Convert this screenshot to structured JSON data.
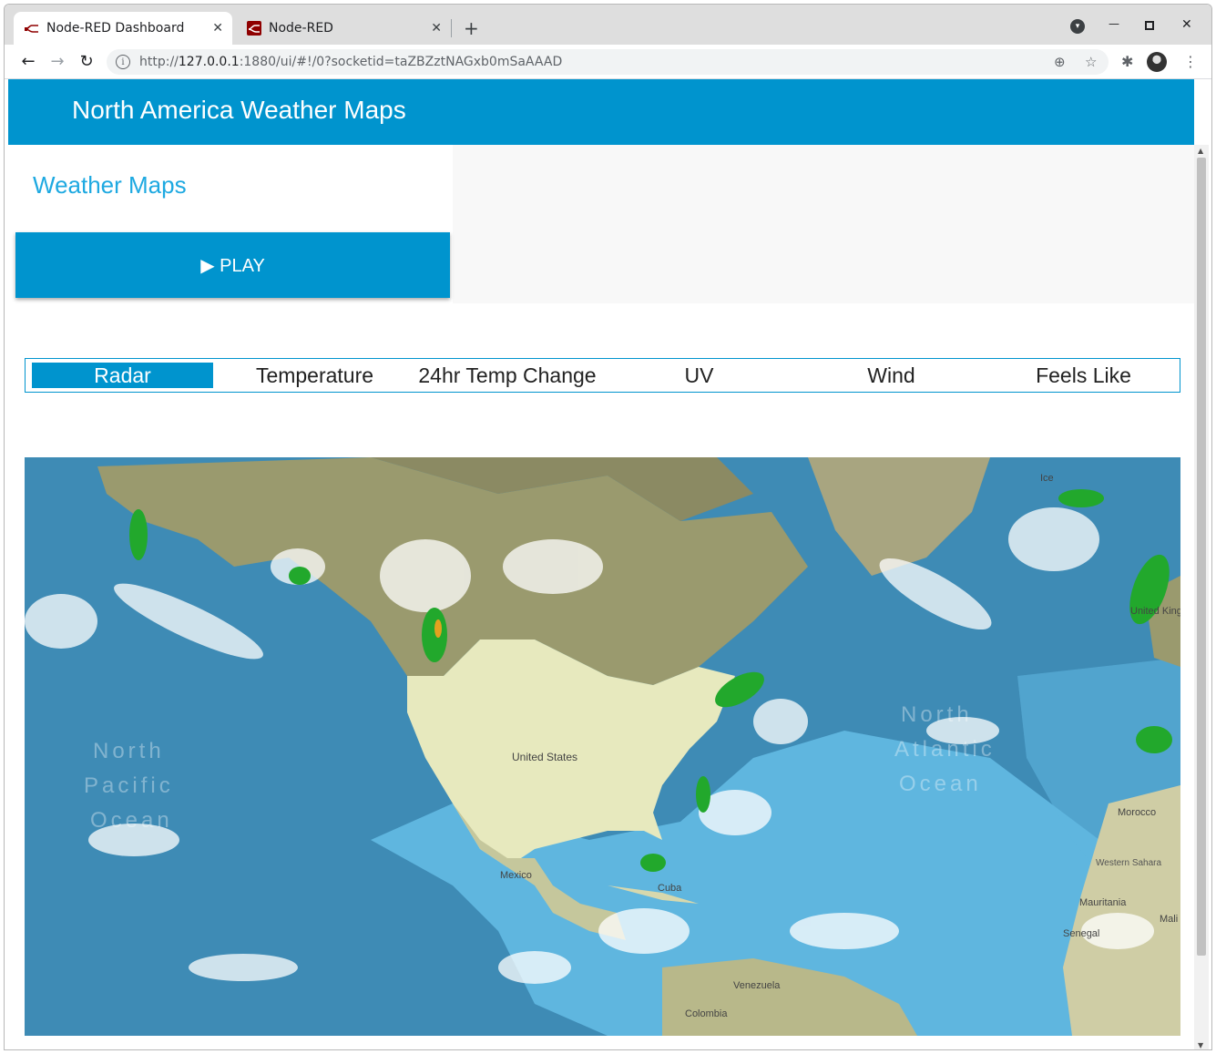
{
  "browser": {
    "tabs": [
      {
        "title": "Node-RED Dashboard",
        "active": true
      },
      {
        "title": "Node-RED",
        "active": false
      }
    ],
    "tab_close": "✕",
    "new_tab": "+",
    "url": {
      "scheme": "http://",
      "host": "127.0.0.1",
      "rest": ":1880/ui/#!/0?socketid=taZBZztNAGxb0mSaAAAD"
    },
    "icons": [
      "back-icon",
      "forward-icon",
      "reload-icon",
      "info-icon",
      "zoom-icon",
      "star-icon",
      "extensions-icon",
      "avatar",
      "menu-icon",
      "minimize-icon",
      "maximize-icon",
      "close-window-icon",
      "tab-search-icon"
    ],
    "glyphs": {
      "back": "←",
      "forward": "→",
      "reload": "↻",
      "info": "i",
      "zoom": "⊕",
      "star": "☆",
      "extensions": "✱",
      "menu": "⋮",
      "minimize": "—",
      "maximize": "▫",
      "close": "✕",
      "tab_search": "▾"
    }
  },
  "dashboard": {
    "title": "North America Weather Maps",
    "group_title": "Weather Maps",
    "play_button": "▶ PLAY",
    "map_tabs": [
      "Radar",
      "Temperature",
      "24hr Temp Change",
      "UV",
      "Wind",
      "Feels Like"
    ],
    "selected_tab": "Radar",
    "accent_color": "#0094ce"
  },
  "map": {
    "labels": {
      "usa": "United States",
      "mexico": "Mexico",
      "cuba": "Cuba",
      "venezuela": "Venezuela",
      "colombia": "Colombia",
      "morocco": "Morocco",
      "western_sahara": "Western Sahara",
      "mauritania": "Mauritania",
      "mali": "Mali",
      "senegal": "Senegal",
      "uk": "United Kingdom",
      "iceland": "Ice",
      "pacific_1": "North",
      "pacific_2": "Pacific",
      "pacific_3": "Ocean",
      "atlantic_1": "North",
      "atlantic_2": "Atlantic",
      "atlantic_3": "Ocean"
    }
  }
}
